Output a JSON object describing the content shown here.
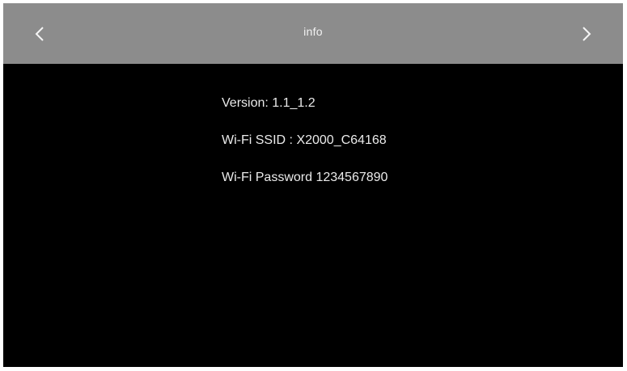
{
  "header": {
    "title": "info",
    "back_icon": "chevron-left-icon",
    "forward_icon": "chevron-right-icon",
    "bar_color": "#8c8c8c"
  },
  "info": {
    "version": "Version: 1.1_1.2",
    "wifi_ssid": "Wi-Fi SSID : X2000_C64168",
    "wifi_password": "Wi-Fi Password 1234567890"
  },
  "colors": {
    "background": "#000000",
    "text": "#eaeaea"
  }
}
